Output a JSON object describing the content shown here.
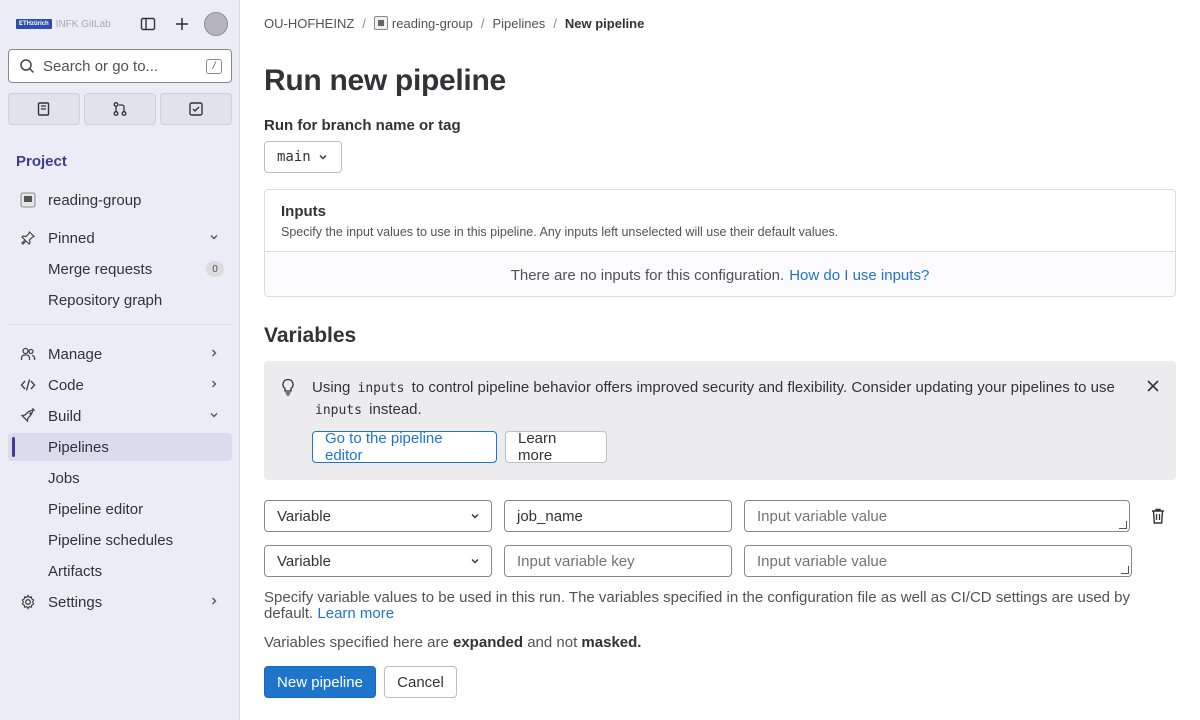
{
  "sidebar": {
    "logo_text": "INFK GitLab",
    "logo_mark": "ETHzürich",
    "search_placeholder": "Search or go to...",
    "search_shortcut": "/",
    "section_title": "Project",
    "project_name": "reading-group",
    "pinned_label": "Pinned",
    "pinned_items": [
      {
        "label": "Merge requests",
        "badge": "0"
      },
      {
        "label": "Repository graph"
      }
    ],
    "groups": [
      {
        "label": "Manage",
        "icon": "users-icon"
      },
      {
        "label": "Code",
        "icon": "code-icon"
      },
      {
        "label": "Build",
        "icon": "rocket-icon"
      }
    ],
    "build_items": [
      "Pipelines",
      "Jobs",
      "Pipeline editor",
      "Pipeline schedules",
      "Artifacts"
    ],
    "settings_label": "Settings",
    "active_item": "Pipelines",
    "accent_color": "#3d3b94"
  },
  "breadcrumb": {
    "items": [
      "OU-HOFHEINZ",
      "reading-group",
      "Pipelines",
      "New pipeline"
    ]
  },
  "page": {
    "title": "Run new pipeline",
    "branch_label": "Run for branch name or tag",
    "branch_value": "main"
  },
  "inputs": {
    "title": "Inputs",
    "description": "Specify the input values to use in this pipeline. Any inputs left unselected will use their default values.",
    "empty_text": "There are no inputs for this configuration.",
    "help_link": "How do I use inputs?"
  },
  "variables": {
    "heading": "Variables",
    "alert": {
      "text_using": "Using",
      "code_1": "inputs",
      "text_mid": "to control pipeline behavior offers improved security and flexibility. Consider updating your pipelines to use",
      "code_2": "inputs",
      "text_end": "instead.",
      "primary_button": "Go to the pipeline editor",
      "secondary_button": "Learn more"
    },
    "rows": [
      {
        "type": "Variable",
        "key": "job_name",
        "key_placeholder": "Input variable key",
        "value_placeholder": "Input variable value"
      },
      {
        "type": "Variable",
        "key": "",
        "key_placeholder": "Input variable key",
        "value_placeholder": "Input variable value"
      }
    ],
    "help_text": "Specify variable values to be used in this run. The variables specified in the configuration file as well as CI/CD settings are used by default.",
    "help_link": "Learn more",
    "expanded_prefix": "Variables specified here are",
    "expanded_word": "expanded",
    "expanded_mid": "and not",
    "masked_word": "masked."
  },
  "actions": {
    "submit": "New pipeline",
    "cancel": "Cancel"
  },
  "colors": {
    "primary": "#1f75cb",
    "sidebar_bg": "#ececf6"
  }
}
